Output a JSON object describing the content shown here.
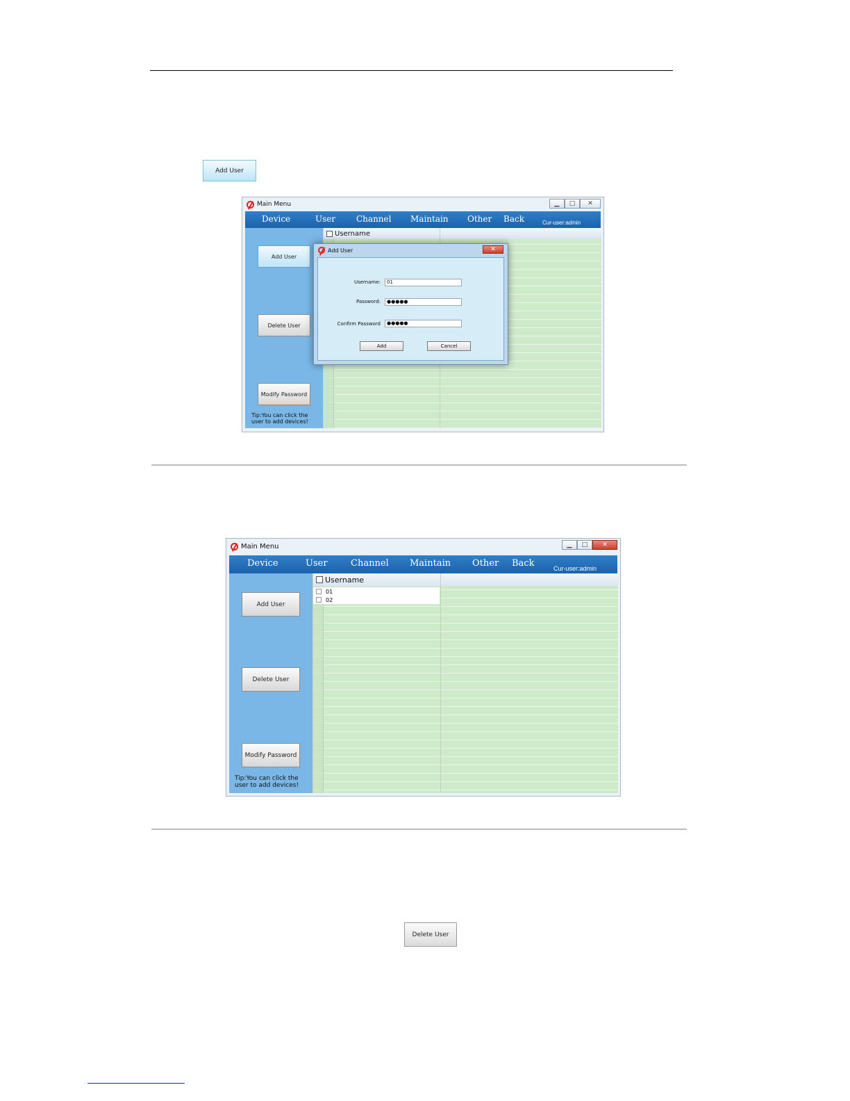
{
  "standalone": {
    "add_user_label": "Add User",
    "delete_user_label": "Delete User"
  },
  "window1": {
    "title": "Main Menu",
    "menu": [
      "Device",
      "User",
      "Channel",
      "Maintain",
      "Other",
      "Back"
    ],
    "cur_user": "Cur-user:admin",
    "sidebar": {
      "add_user": "Add User",
      "delete_user": "Delete User",
      "modify_password": "Modify Password",
      "tip": "Tip:You can click the user to add devices!"
    },
    "table_header": "Username",
    "dialog": {
      "title": "Add User",
      "username_label": "Username:",
      "username_value": "01",
      "password_label": "Password:",
      "password_value": "●●●●●",
      "confirm_label": "Confirm Password",
      "confirm_value": "●●●●●",
      "add_label": "Add",
      "cancel_label": "Cancel"
    }
  },
  "window2": {
    "title": "Main Menu",
    "menu": [
      "Device",
      "User",
      "Channel",
      "Maintain",
      "Other",
      "Back"
    ],
    "cur_user": "Cur-user:admin",
    "sidebar": {
      "add_user": "Add User",
      "delete_user": "Delete User",
      "modify_password": "Modify Password",
      "tip": "Tip:You can click the user to add devices!"
    },
    "table_header": "Username",
    "rows": [
      "01",
      "02"
    ]
  }
}
